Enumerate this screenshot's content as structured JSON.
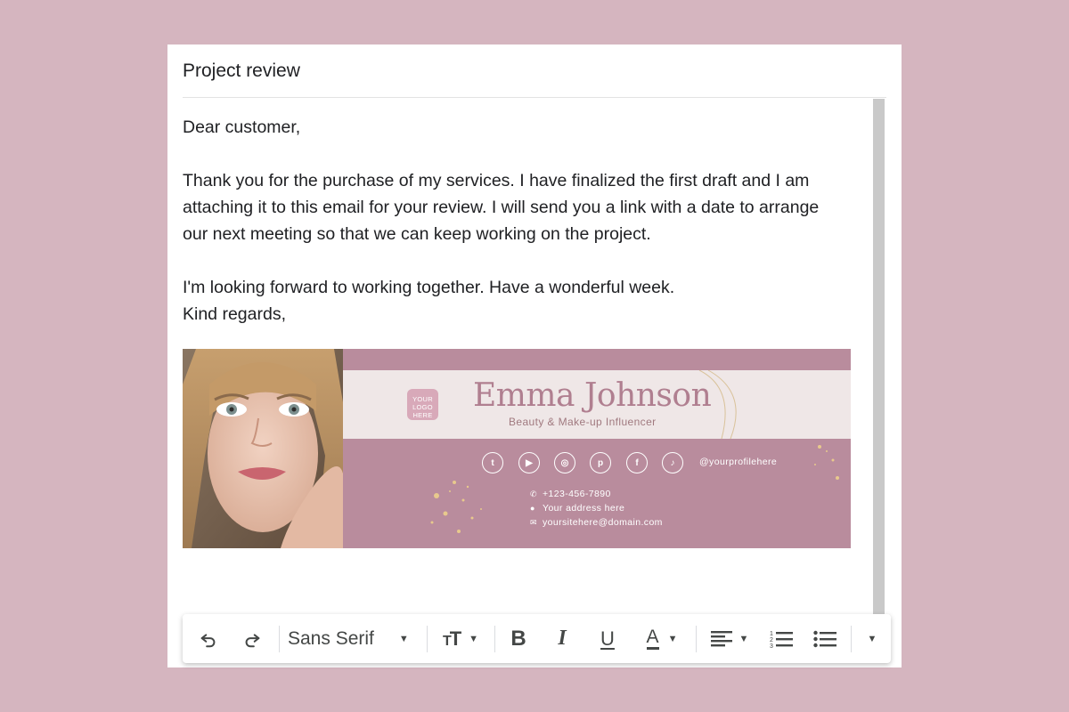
{
  "email": {
    "subject": "Project review",
    "greeting": "Dear customer,",
    "paragraph1_line1": "Thank you for the purchase of my services. I have finalized the first draft and I am",
    "paragraph1_line2": "attaching it to this email for your review. I will send you a link with a date to arrange",
    "paragraph1_line3": "our next meeting so that we can keep working on the project.",
    "paragraph2": "I'm looking forward to working together. Have a wonderful week.",
    "closing": "Kind regards,"
  },
  "signature": {
    "logo_line1": "YOUR",
    "logo_line2": "LOGO",
    "logo_line3": "HERE",
    "name": "Emma Johnson",
    "role": "Beauty & Make-up Influencer",
    "social_icons": [
      "twitter-icon",
      "youtube-icon",
      "instagram-icon",
      "pinterest-icon",
      "facebook-icon",
      "tiktok-icon"
    ],
    "handle": "@yourprofilehere",
    "phone": "+123-456-7890",
    "address": "Your address here",
    "website": "yoursitehere@domain.com",
    "colors": {
      "band": "#b98c9d",
      "light": "#efe7e7",
      "name": "#b07f90"
    }
  },
  "toolbar": {
    "font_family": "Sans Serif",
    "icons": [
      "undo-icon",
      "redo-icon",
      "text-size-icon",
      "bold-icon",
      "italic-icon",
      "underline-icon",
      "text-color-icon",
      "align-icon",
      "numbered-list-icon",
      "bulleted-list-icon",
      "more-options-icon"
    ]
  }
}
